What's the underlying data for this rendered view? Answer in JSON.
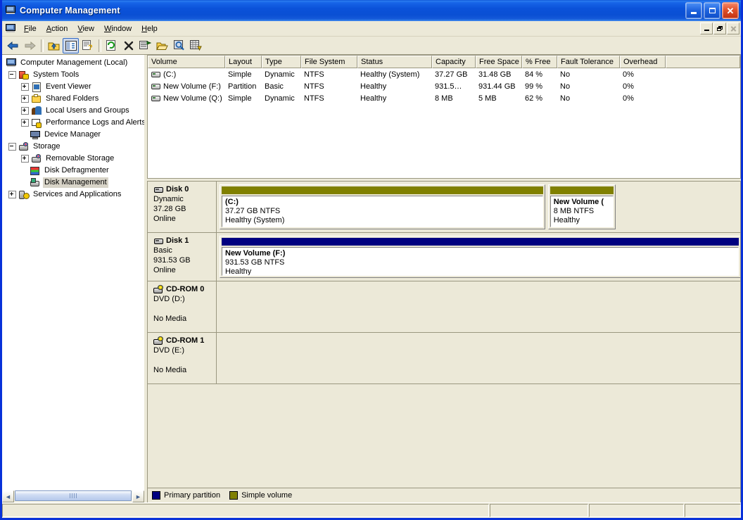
{
  "window": {
    "title": "Computer Management",
    "icon": "computer-icon",
    "buttons": {
      "minimize": "_",
      "maximize": "□",
      "close": "✕"
    }
  },
  "menubar": {
    "system_icon": "computer-icon",
    "items": [
      {
        "label": "File",
        "accel": "F"
      },
      {
        "label": "Action",
        "accel": "A"
      },
      {
        "label": "View",
        "accel": "V"
      },
      {
        "label": "Window",
        "accel": "W"
      },
      {
        "label": "Help",
        "accel": "H"
      }
    ],
    "mdi_buttons": [
      "minimize",
      "restore",
      "close"
    ]
  },
  "toolbar": {
    "items": [
      {
        "name": "back-icon",
        "glyph": "⬅"
      },
      {
        "name": "forward-icon",
        "glyph": "➡"
      },
      {
        "name": "up-one-level-icon",
        "glyph": "folder-up"
      },
      {
        "name": "show-hide-console-tree-icon",
        "glyph": "tree-pane",
        "pressed": true
      },
      {
        "name": "properties-icon",
        "glyph": "properties"
      },
      {
        "name": "refresh-icon",
        "glyph": "refresh"
      },
      {
        "name": "delete-icon",
        "glyph": "✕"
      },
      {
        "name": "rescan-disks-icon",
        "glyph": "rescan"
      },
      {
        "name": "open-icon",
        "glyph": "open-folder"
      },
      {
        "name": "find-icon",
        "glyph": "magnifier"
      },
      {
        "name": "help-topics-icon",
        "glyph": "help-grid"
      }
    ]
  },
  "tree": {
    "root": {
      "label": "Computer Management (Local)",
      "icon": "computer-icon"
    },
    "items": [
      {
        "label": "System Tools",
        "icon": "system-tools-icon",
        "level": 1,
        "expander": "minus"
      },
      {
        "label": "Event Viewer",
        "icon": "event-viewer-icon",
        "level": 2,
        "expander": "plus"
      },
      {
        "label": "Shared Folders",
        "icon": "shared-folders-icon",
        "level": 2,
        "expander": "plus"
      },
      {
        "label": "Local Users and Groups",
        "icon": "local-users-icon",
        "level": 2,
        "expander": "plus"
      },
      {
        "label": "Performance Logs and Alerts",
        "icon": "performance-logs-icon",
        "level": 2,
        "expander": "plus"
      },
      {
        "label": "Device Manager",
        "icon": "device-manager-icon",
        "level": 2,
        "expander": "none"
      },
      {
        "label": "Storage",
        "icon": "storage-icon",
        "level": 1,
        "expander": "minus"
      },
      {
        "label": "Removable Storage",
        "icon": "removable-storage-icon",
        "level": 2,
        "expander": "plus"
      },
      {
        "label": "Disk Defragmenter",
        "icon": "disk-defragmenter-icon",
        "level": 2,
        "expander": "none"
      },
      {
        "label": "Disk Management",
        "icon": "disk-management-icon",
        "level": 2,
        "expander": "none",
        "selected": true
      },
      {
        "label": "Services and Applications",
        "icon": "services-icon",
        "level": 1,
        "expander": "plus"
      }
    ],
    "hscrollbar": {
      "left_arrow": "‹",
      "right_arrow": "›"
    }
  },
  "volume_list": {
    "columns": [
      {
        "label": "Volume",
        "width": 110
      },
      {
        "label": "Layout",
        "width": 52
      },
      {
        "label": "Type",
        "width": 56
      },
      {
        "label": "File System",
        "width": 80
      },
      {
        "label": "Status",
        "width": 106
      },
      {
        "label": "Capacity",
        "width": 62
      },
      {
        "label": "Free Space",
        "width": 66
      },
      {
        "label": "% Free",
        "width": 50
      },
      {
        "label": "Fault Tolerance",
        "width": 89
      },
      {
        "label": "Overhead",
        "width": 65
      },
      {
        "label": "",
        "width": 150
      }
    ],
    "rows": [
      {
        "icon": "volume-icon",
        "volume": "(C:)",
        "layout": "Simple",
        "type": "Dynamic",
        "file_system": "NTFS",
        "status": "Healthy (System)",
        "capacity": "37.27 GB",
        "free_space": "31.48 GB",
        "percent_free": "84 %",
        "fault_tolerance": "No",
        "overhead": "0%"
      },
      {
        "icon": "volume-icon",
        "volume": "New Volume (F:)",
        "layout": "Partition",
        "type": "Basic",
        "file_system": "NTFS",
        "status": "Healthy",
        "capacity": "931.5…",
        "free_space": "931.44 GB",
        "percent_free": "99 %",
        "fault_tolerance": "No",
        "overhead": "0%"
      },
      {
        "icon": "volume-icon",
        "volume": "New Volume (Q:)",
        "layout": "Simple",
        "type": "Dynamic",
        "file_system": "NTFS",
        "status": "Healthy",
        "capacity": "8 MB",
        "free_space": "5 MB",
        "percent_free": "62 %",
        "fault_tolerance": "No",
        "overhead": "0%"
      }
    ]
  },
  "disk_view": {
    "disks": [
      {
        "name": "Disk 0",
        "icon": "disk-icon",
        "type": "Dynamic",
        "size": "37.28 GB",
        "status": "Online",
        "height": 72,
        "partitions": [
          {
            "name": "(C:)",
            "size_fs": "37.27 GB NTFS",
            "status": "Healthy (System)",
            "bar_color": "#808000",
            "flex": 472
          },
          {
            "name": "New Volume (",
            "size_fs": "8 MB NTFS",
            "status": "Healthy",
            "bar_color": "#808000",
            "flex": 93
          }
        ],
        "trailing_empty": true
      },
      {
        "name": "Disk 1",
        "icon": "disk-icon",
        "type": "Basic",
        "size": "931.53 GB",
        "status": "Online",
        "height": 68,
        "partitions": [
          {
            "name": "New Volume  (F:)",
            "size_fs": "931.53 GB NTFS",
            "status": "Healthy",
            "bar_color": "#000080",
            "flex": 1000
          }
        ],
        "trailing_empty": false
      },
      {
        "name": "CD-ROM 0",
        "icon": "cdrom-icon",
        "type": "DVD (D:)",
        "size": "",
        "status": "No Media",
        "height": 72,
        "partitions": [],
        "trailing_empty": true
      },
      {
        "name": "CD-ROM 1",
        "icon": "cdrom-icon",
        "type": "DVD (E:)",
        "size": "",
        "status": "No Media",
        "height": 72,
        "partitions": [],
        "trailing_empty": true
      }
    ]
  },
  "legend": {
    "items": [
      {
        "label": "Primary partition",
        "color": "#000080"
      },
      {
        "label": "Simple volume",
        "color": "#808000"
      }
    ]
  },
  "statusbar": {
    "panels": [
      "",
      "",
      "",
      ""
    ]
  }
}
